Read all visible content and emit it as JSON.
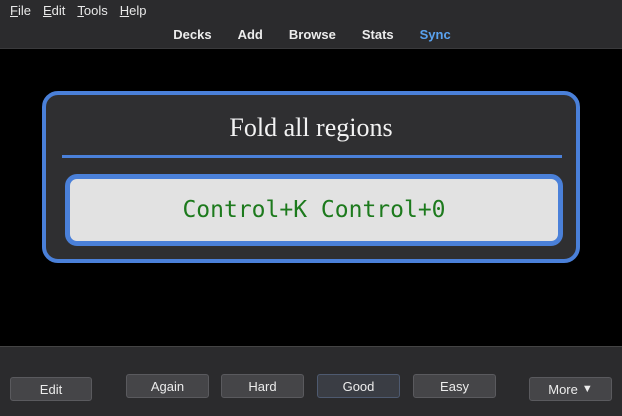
{
  "menu": {
    "items": [
      {
        "accel": "F",
        "rest": "ile"
      },
      {
        "accel": "E",
        "rest": "dit"
      },
      {
        "accel": "T",
        "rest": "ools"
      },
      {
        "accel": "H",
        "rest": "elp"
      }
    ]
  },
  "toolbar": {
    "decks": "Decks",
    "add": "Add",
    "browse": "Browse",
    "stats": "Stats",
    "sync": "Sync",
    "sync_color": "#5aa3f0"
  },
  "card": {
    "question": "Fold all regions",
    "answer": "Control+K Control+0",
    "accent_color": "#4a80d9",
    "answer_color": "#1d7a1d"
  },
  "bottom": {
    "edit": "Edit",
    "again": "Again",
    "hard": "Hard",
    "good": "Good",
    "easy": "Easy",
    "more": "More",
    "more_icon": "caret-down-icon"
  }
}
